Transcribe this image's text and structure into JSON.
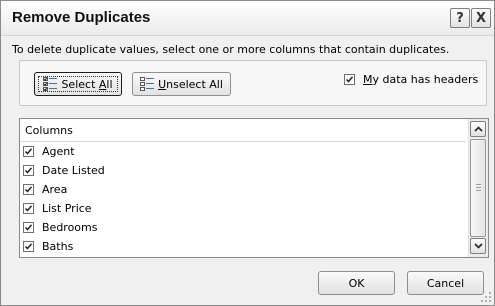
{
  "dialog": {
    "title": "Remove Duplicates",
    "help_glyph": "?",
    "close_glyph": "X",
    "instructions": "To delete duplicate values, select one or more columns that contain duplicates."
  },
  "buttons": {
    "select_all": {
      "pre": "Select ",
      "key": "A",
      "post": "ll"
    },
    "unselect_all": {
      "pre": "",
      "key": "U",
      "post": "nselect All"
    },
    "ok": "OK",
    "cancel": "Cancel"
  },
  "headers_option": {
    "key": "M",
    "post": "y data has headers",
    "checked": true
  },
  "columns": {
    "header": "Columns",
    "items": [
      {
        "label": "Agent",
        "checked": true
      },
      {
        "label": "Date Listed",
        "checked": true
      },
      {
        "label": "Area",
        "checked": true
      },
      {
        "label": "List Price",
        "checked": true
      },
      {
        "label": "Bedrooms",
        "checked": true
      },
      {
        "label": "Baths",
        "checked": true
      }
    ]
  },
  "icons": {
    "help": "help-icon",
    "close": "close-icon",
    "select_all": "select-all-list-icon",
    "unselect_all": "unselect-all-list-icon",
    "check": "checkmark-icon",
    "scroll_up": "chevron-up-icon",
    "scroll_down": "chevron-down-icon",
    "resize": "resize-grip-icon"
  }
}
